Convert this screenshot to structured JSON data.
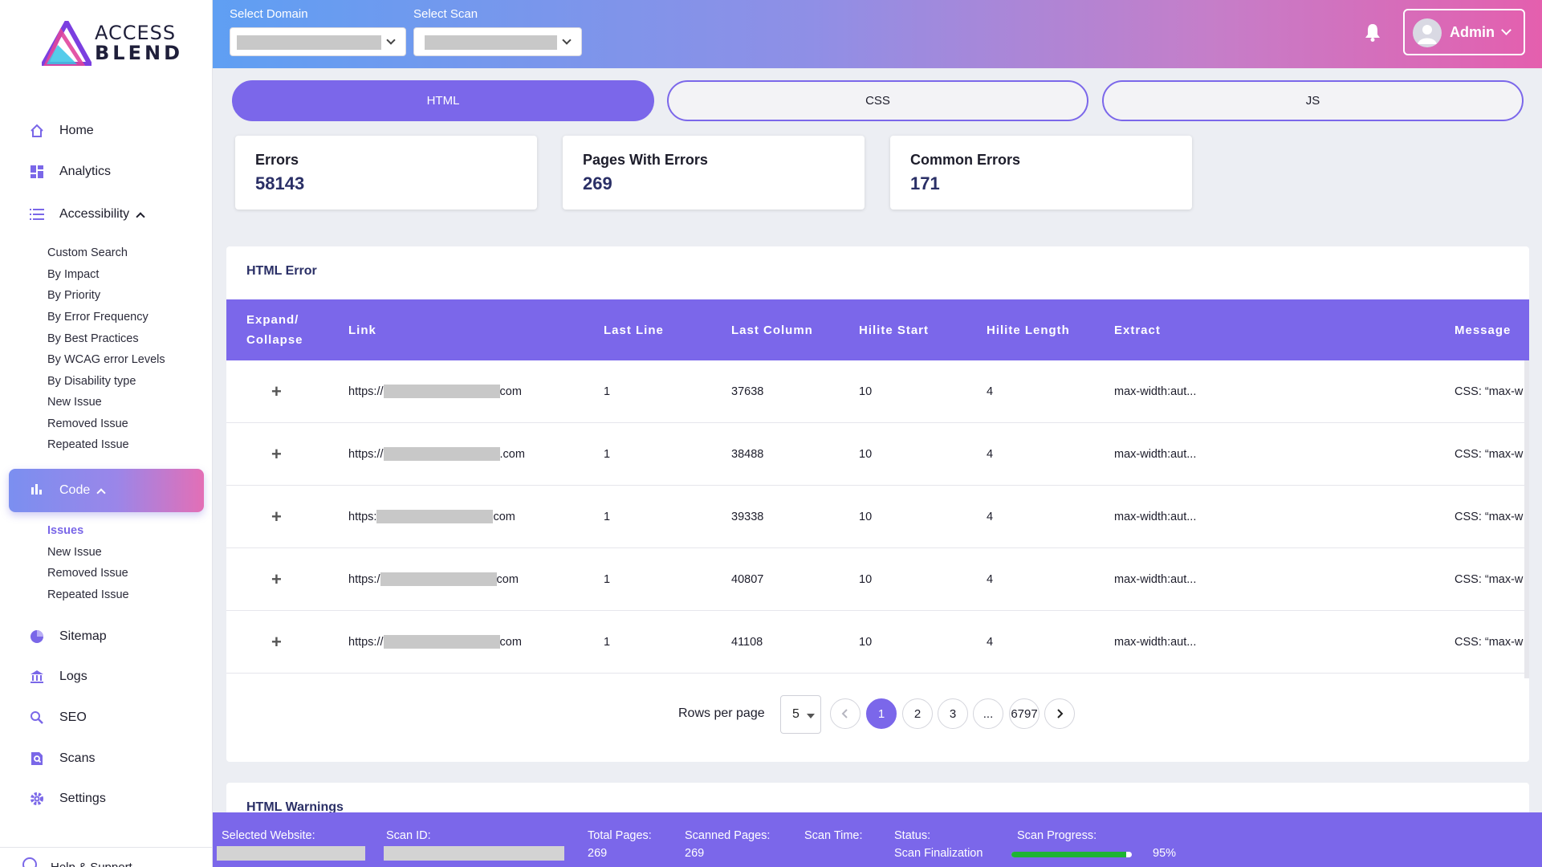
{
  "brand": {
    "line1": "ACCESS",
    "line2": "BLEND"
  },
  "sidebar": {
    "items": [
      {
        "label": "Home",
        "icon": "home-icon"
      },
      {
        "label": "Analytics",
        "icon": "dashboard-icon"
      },
      {
        "label": "Accessibility",
        "icon": "list-icon"
      },
      {
        "label": "Code",
        "icon": "bar-chart-icon"
      },
      {
        "label": "Sitemap",
        "icon": "pie-chart-icon"
      },
      {
        "label": "Logs",
        "icon": "bank-icon"
      },
      {
        "label": "SEO",
        "icon": "search-icon"
      },
      {
        "label": "Scans",
        "icon": "document-search-icon"
      },
      {
        "label": "Settings",
        "icon": "gear-icon"
      }
    ],
    "accessibility_sub": [
      "Custom Search",
      "By Impact",
      "By Priority",
      "By Error Frequency",
      "By Best Practices",
      "By WCAG error Levels",
      "By Disability type",
      "New Issue",
      "Removed Issue",
      "Repeated Issue"
    ],
    "code_sub": [
      "Issues",
      "New Issue",
      "Removed Issue",
      "Repeated Issue"
    ],
    "help": "Help & Support"
  },
  "topbar": {
    "domain_label": "Select Domain",
    "scan_label": "Select Scan",
    "user": "Admin"
  },
  "tabs": [
    "HTML",
    "CSS",
    "JS"
  ],
  "stats": [
    {
      "title": "Errors",
      "value": "58143"
    },
    {
      "title": "Pages With Errors",
      "value": "269"
    },
    {
      "title": "Common Errors",
      "value": "171"
    }
  ],
  "table": {
    "title": "HTML Error",
    "headers": {
      "expand_1": "Expand/",
      "expand_2": "Collapse",
      "link": "Link",
      "last_line": "Last Line",
      "last_column": "Last Column",
      "hilite_start": "Hilite Start",
      "hilite_length": "Hilite Length",
      "extract": "Extract",
      "message": "Message"
    },
    "rows": [
      {
        "link_prefix": "https://",
        "link_suffix": "com",
        "last_line": "1",
        "last_column": "37638",
        "hilite_start": "10",
        "hilite_length": "4",
        "extract": "max-width:aut...",
        "message": "CSS: “max-w"
      },
      {
        "link_prefix": "https://",
        "link_suffix": ".com",
        "last_line": "1",
        "last_column": "38488",
        "hilite_start": "10",
        "hilite_length": "4",
        "extract": "max-width:aut...",
        "message": "CSS: “max-w"
      },
      {
        "link_prefix": "https:",
        "link_suffix": "com",
        "last_line": "1",
        "last_column": "39338",
        "hilite_start": "10",
        "hilite_length": "4",
        "extract": "max-width:aut...",
        "message": "CSS: “max-w"
      },
      {
        "link_prefix": "https:/",
        "link_suffix": "com",
        "last_line": "1",
        "last_column": "40807",
        "hilite_start": "10",
        "hilite_length": "4",
        "extract": "max-width:aut...",
        "message": "CSS: “max-w"
      },
      {
        "link_prefix": "https://",
        "link_suffix": "com",
        "last_line": "1",
        "last_column": "41108",
        "hilite_start": "10",
        "hilite_length": "4",
        "extract": "max-width:aut...",
        "message": "CSS: “max-w"
      }
    ],
    "rows_per_page_label": "Rows per page",
    "rows_per_page": "5",
    "pages": [
      "1",
      "2",
      "3",
      "...",
      "6797"
    ],
    "current_page": "1"
  },
  "warnings_title": "HTML Warnings",
  "statusbar": {
    "selected_website_label": "Selected Website:",
    "scan_id_label": "Scan ID:",
    "total_pages_label": "Total Pages:",
    "total_pages": "269",
    "scanned_pages_label": "Scanned Pages:",
    "scanned_pages": "269",
    "scan_time_label": "Scan Time:",
    "status_label": "Status:",
    "status": "Scan Finalization",
    "progress_label": "Scan Progress:",
    "progress_text": "95%",
    "progress_fraction": 0.95
  },
  "colors": {
    "accent": "#7b67ea",
    "progress": "#1db433"
  }
}
